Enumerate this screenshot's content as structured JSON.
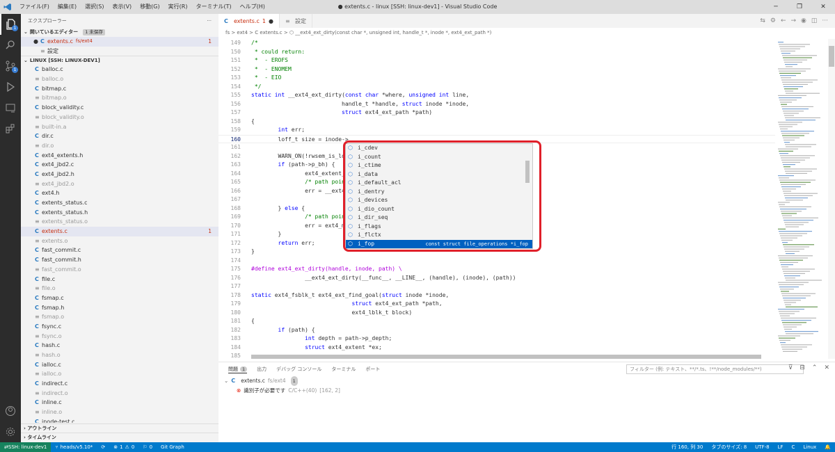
{
  "window": {
    "title": "● extents.c - linux [SSH: linux-dev1] - Visual Studio Code"
  },
  "menu": [
    "ファイル(F)",
    "編集(E)",
    "選択(S)",
    "表示(V)",
    "移動(G)",
    "実行(R)",
    "ターミナル(T)",
    "ヘルプ(H)"
  ],
  "activity_badges": {
    "scm": "1"
  },
  "sidebar": {
    "title": "エクスプローラー",
    "open_editors": {
      "label": "開いているエディター",
      "unsaved": "1 未保存",
      "items": [
        {
          "name": "extents.c",
          "path": "fs/ext4",
          "count": "1"
        },
        {
          "name": "設定",
          "path": "",
          "count": ""
        }
      ]
    },
    "workspace": {
      "label": "LINUX [SSH: LINUX-DEV1]",
      "files": [
        {
          "name": "balloc.c",
          "kind": "c"
        },
        {
          "name": "balloc.o",
          "kind": "o"
        },
        {
          "name": "bitmap.c",
          "kind": "c"
        },
        {
          "name": "bitmap.o",
          "kind": "o"
        },
        {
          "name": "block_validity.c",
          "kind": "c"
        },
        {
          "name": "block_validity.o",
          "kind": "o"
        },
        {
          "name": "built-in.a",
          "kind": "o"
        },
        {
          "name": "dir.c",
          "kind": "c"
        },
        {
          "name": "dir.o",
          "kind": "o"
        },
        {
          "name": "ext4_extents.h",
          "kind": "c"
        },
        {
          "name": "ext4_jbd2.c",
          "kind": "c"
        },
        {
          "name": "ext4_jbd2.h",
          "kind": "c"
        },
        {
          "name": "ext4_jbd2.o",
          "kind": "o"
        },
        {
          "name": "ext4.h",
          "kind": "c"
        },
        {
          "name": "extents_status.c",
          "kind": "c"
        },
        {
          "name": "extents_status.h",
          "kind": "c"
        },
        {
          "name": "extents_status.o",
          "kind": "o"
        },
        {
          "name": "extents.c",
          "kind": "err",
          "count": "1"
        },
        {
          "name": "extents.o",
          "kind": "o"
        },
        {
          "name": "fast_commit.c",
          "kind": "c"
        },
        {
          "name": "fast_commit.h",
          "kind": "c"
        },
        {
          "name": "fast_commit.o",
          "kind": "o"
        },
        {
          "name": "file.c",
          "kind": "c"
        },
        {
          "name": "file.o",
          "kind": "o"
        },
        {
          "name": "fsmap.c",
          "kind": "c"
        },
        {
          "name": "fsmap.h",
          "kind": "c"
        },
        {
          "name": "fsmap.o",
          "kind": "o"
        },
        {
          "name": "fsync.c",
          "kind": "c"
        },
        {
          "name": "fsync.o",
          "kind": "o"
        },
        {
          "name": "hash.c",
          "kind": "c"
        },
        {
          "name": "hash.o",
          "kind": "o"
        },
        {
          "name": "ialloc.c",
          "kind": "c"
        },
        {
          "name": "ialloc.o",
          "kind": "o"
        },
        {
          "name": "indirect.c",
          "kind": "c"
        },
        {
          "name": "indirect.o",
          "kind": "o"
        },
        {
          "name": "inline.c",
          "kind": "c"
        },
        {
          "name": "inline.o",
          "kind": "o"
        },
        {
          "name": "inode-test.c",
          "kind": "c"
        }
      ]
    },
    "outline": "アウトライン",
    "timeline": "タイムライン"
  },
  "tabs": [
    {
      "name": "extents.c",
      "count": "1",
      "dirty": "●"
    },
    {
      "name": "設定"
    }
  ],
  "breadcrumb": "fs > ext4 > C extents.c > ⬡ __ext4_ext_dirty(const char *, unsigned int, handle_t *, inode *, ext4_ext_path *)",
  "code": [
    {
      "n": "149",
      "t": "/*",
      "cls": "c"
    },
    {
      "n": "150",
      "t": " * could return:",
      "cls": "c"
    },
    {
      "n": "151",
      "t": " *  - EROFS",
      "cls": "c"
    },
    {
      "n": "152",
      "t": " *  - ENOMEM",
      "cls": "c"
    },
    {
      "n": "153",
      "t": " *  - EIO",
      "cls": "c"
    },
    {
      "n": "154",
      "t": " */",
      "cls": "c"
    },
    {
      "n": "155",
      "t": "static int __ext4_ext_dirty(const char *where, unsigned int line,",
      "cls": ""
    },
    {
      "n": "156",
      "t": "                           handle_t *handle, struct inode *inode,",
      "cls": ""
    },
    {
      "n": "157",
      "t": "                           struct ext4_ext_path *path)",
      "cls": ""
    },
    {
      "n": "158",
      "t": "{",
      "cls": ""
    },
    {
      "n": "159",
      "t": "        int err;",
      "cls": ""
    },
    {
      "n": "160",
      "t": "        loff_t size = inode->",
      "cls": "",
      "cur": true
    },
    {
      "n": "161",
      "t": "",
      "cls": ""
    },
    {
      "n": "162",
      "t": "        WARN_ON(!rwsem_is_loc",
      "cls": ""
    },
    {
      "n": "163",
      "t": "        if (path->p_bh) {",
      "cls": ""
    },
    {
      "n": "164",
      "t": "                ext4_extent_b",
      "cls": ""
    },
    {
      "n": "165",
      "t": "                /* path point",
      "cls": "c"
    },
    {
      "n": "166",
      "t": "                err = __ext4",
      "cls": ""
    },
    {
      "n": "167",
      "t": "",
      "cls": ""
    },
    {
      "n": "168",
      "t": "        } else {",
      "cls": ""
    },
    {
      "n": "169",
      "t": "                /* path point",
      "cls": "c"
    },
    {
      "n": "170",
      "t": "                err = ext4_ma",
      "cls": ""
    },
    {
      "n": "171",
      "t": "        }",
      "cls": ""
    },
    {
      "n": "172",
      "t": "        return err;",
      "cls": ""
    },
    {
      "n": "173",
      "t": "}",
      "cls": ""
    },
    {
      "n": "174",
      "t": "",
      "cls": ""
    },
    {
      "n": "175",
      "t": "#define ext4_ext_dirty(handle, inode, path) \\",
      "cls": "p"
    },
    {
      "n": "176",
      "t": "                __ext4_ext_dirty(__func__, __LINE__, (handle), (inode), (path))",
      "cls": ""
    },
    {
      "n": "177",
      "t": "",
      "cls": ""
    },
    {
      "n": "178",
      "t": "static ext4_fsblk_t ext4_ext_find_goal(struct inode *inode,",
      "cls": ""
    },
    {
      "n": "179",
      "t": "                              struct ext4_ext_path *path,",
      "cls": ""
    },
    {
      "n": "180",
      "t": "                              ext4_lblk_t block)",
      "cls": ""
    },
    {
      "n": "181",
      "t": "{",
      "cls": ""
    },
    {
      "n": "182",
      "t": "        if (path) {",
      "cls": ""
    },
    {
      "n": "183",
      "t": "                int depth = path->p_depth;",
      "cls": ""
    },
    {
      "n": "184",
      "t": "                struct ext4_extent *ex;",
      "cls": ""
    },
    {
      "n": "185",
      "t": "",
      "cls": ""
    }
  ],
  "suggestions": [
    {
      "label": "i_cdev"
    },
    {
      "label": "i_count"
    },
    {
      "label": "i_ctime"
    },
    {
      "label": "i_data"
    },
    {
      "label": "i_default_acl"
    },
    {
      "label": "i_dentry"
    },
    {
      "label": "i_devices"
    },
    {
      "label": "i_dio_count"
    },
    {
      "label": "i_dir_seq"
    },
    {
      "label": "i_flags"
    },
    {
      "label": "i_flctx"
    },
    {
      "label": "i_fop",
      "detail": "const struct file_operations *i_fop",
      "selected": true
    }
  ],
  "panel": {
    "tabs": [
      "問題",
      "出力",
      "デバッグ コンソール",
      "ターミナル",
      "ポート"
    ],
    "problems_count": "1",
    "filter_placeholder": "フィルター (例: テキスト、**/*.ts、!**/node_modules/**)",
    "file": {
      "name": "extents.c",
      "path": "fs/ext4",
      "count": "1"
    },
    "error": {
      "msg": "識別子が必要です",
      "source": "C/C++(40)",
      "pos": "[162, 2]"
    }
  },
  "status": {
    "remote": "SSH: linux-dev1",
    "branch": "heads/v5.10*",
    "errors": "1",
    "warnings": "0",
    "info": "0",
    "gitgraph": "Git Graph",
    "position": "行 160, 列 30",
    "tabsize": "タブのサイズ: 8",
    "encoding": "UTF-8",
    "eol": "LF",
    "lang": "C",
    "os": "Linux"
  }
}
